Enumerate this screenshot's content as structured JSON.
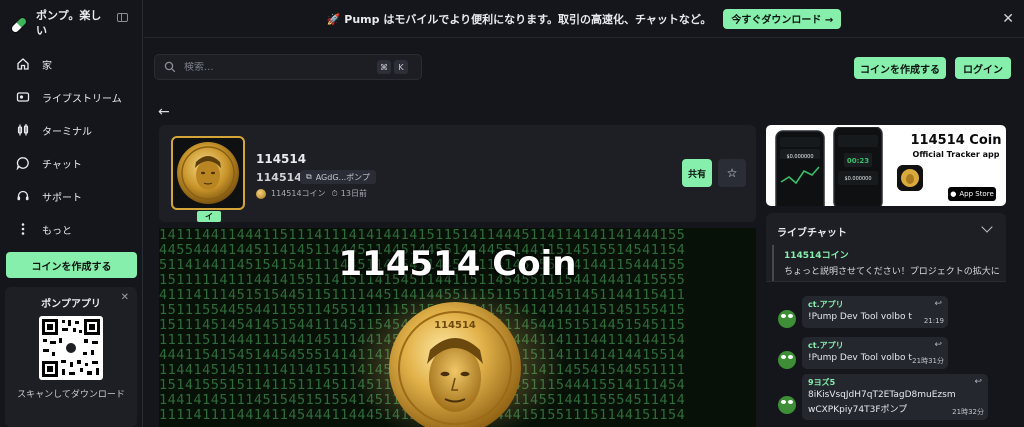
{
  "brand": {
    "name": "ポンプ。楽しい"
  },
  "sidebar": {
    "items": [
      {
        "label": "家",
        "icon": "home-icon"
      },
      {
        "label": "ライブストリーム",
        "icon": "livestream-icon"
      },
      {
        "label": "ターミナル",
        "icon": "terminal-icon"
      },
      {
        "label": "チャット",
        "icon": "chat-icon"
      },
      {
        "label": "サポート",
        "icon": "support-icon"
      },
      {
        "label": "もっと",
        "icon": "more-icon"
      }
    ],
    "create_coin": "コインを作成する",
    "app_card": {
      "title": "ポンプアプリ",
      "scan_text": "スキャンしてダウンロード"
    }
  },
  "banner": {
    "text": "🚀 Pump はモバイルでより便利になります。取引の高速化、チャットなど。",
    "cta": "今すぐダウンロード →"
  },
  "header": {
    "search_placeholder": "検索...",
    "kbd": [
      "⌘",
      "K"
    ],
    "create_coin": "コインを作成する",
    "login": "ログイン"
  },
  "coin": {
    "title": "114514",
    "ticker": "114514",
    "address": "AGdG...ポンプ",
    "creator": "114514コイン",
    "age": "13日前",
    "thumb_badge": "イ",
    "share": "共有",
    "banner_heading": "114514 Coin",
    "coin_text": "114514"
  },
  "promo": {
    "title": "114514 Coin",
    "subtitle": "Official Tracker app",
    "appstore": "App Store",
    "phone_values": [
      "$0.000000",
      "00:23",
      "$0.000000"
    ]
  },
  "chat": {
    "title": "ライブチャット",
    "pinned": {
      "name": "114514コイン",
      "text": "ちょっと説明させてください！プロジェクトの拡大に伴..."
    },
    "messages": [
      {
        "name": "ct.アプリ",
        "text": "!Pump Dev Tool volbo t",
        "time": "21:19"
      },
      {
        "name": "ct.アプリ",
        "text": "!Pump Dev Tool volbo t",
        "time": "21時31分"
      },
      {
        "name": "9ヨズ5",
        "text": "8iKisVsqJdH7qT2ETagD8muEzsm",
        "text2": "wCXPKpiy74T3Fポンプ",
        "time": "21時32分"
      }
    ]
  },
  "colors": {
    "accent": "#86efac",
    "background": "#15161b",
    "card": "#1d1f25",
    "gold": "#d4a63a"
  }
}
